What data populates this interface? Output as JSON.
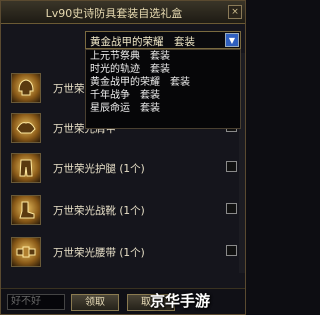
{
  "window": {
    "title": "Lv90史诗防具套装自选礼盒",
    "close_label": "×"
  },
  "dropdown": {
    "selected": "黄金战甲的荣耀　套装",
    "options": [
      "上元节祭典　套装",
      "时光的轨迹　套装",
      "黄金战甲的荣耀　套装",
      "千年战争　套装",
      "星辰命运　套装"
    ]
  },
  "items": [
    {
      "label": "万世荣光…",
      "icon": "helmet-icon"
    },
    {
      "label": "万世荣光肩甲",
      "icon": "shoulder-icon"
    },
    {
      "label": "万世荣光护腿 (1个)",
      "icon": "legs-icon"
    },
    {
      "label": "万世荣光战靴 (1个)",
      "icon": "boots-icon"
    },
    {
      "label": "万世荣光腰带 (1个)",
      "icon": "belt-icon"
    }
  ],
  "footer": {
    "search_placeholder": "好不好",
    "confirm_label": "领取",
    "cancel_label": "取消"
  },
  "watermark": "京华手游"
}
